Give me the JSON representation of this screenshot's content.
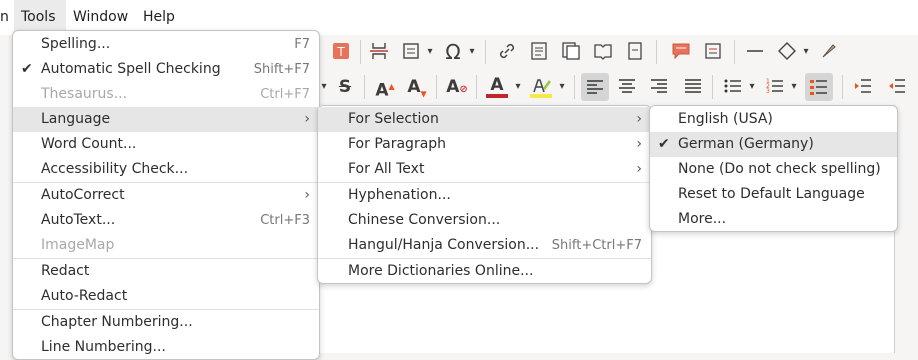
{
  "menubar": {
    "items": [
      {
        "label": "n"
      },
      {
        "label": "Tools"
      },
      {
        "label": "Window"
      },
      {
        "label": "Help"
      }
    ]
  },
  "tools_menu": {
    "items": [
      {
        "label": "Spelling...",
        "accel": "F7"
      },
      {
        "label": "Automatic Spell Checking",
        "accel": "Shift+F7",
        "checked": true
      },
      {
        "label": "Thesaurus...",
        "accel": "Ctrl+F7",
        "disabled": true
      },
      {
        "label": "Language"
      },
      {
        "label": "Word Count..."
      },
      {
        "label": "Accessibility Check..."
      },
      {
        "label": "AutoCorrect"
      },
      {
        "label": "AutoText...",
        "accel": "Ctrl+F3"
      },
      {
        "label": "ImageMap",
        "disabled": true
      },
      {
        "label": "Redact"
      },
      {
        "label": "Auto-Redact"
      },
      {
        "label": "Chapter Numbering..."
      },
      {
        "label": "Line Numbering..."
      }
    ]
  },
  "language_menu": {
    "items": [
      {
        "label": "For Selection"
      },
      {
        "label": "For Paragraph"
      },
      {
        "label": "For All Text"
      },
      {
        "label": "Hyphenation..."
      },
      {
        "label": "Chinese Conversion..."
      },
      {
        "label": "Hangul/Hanja Conversion...",
        "accel": "Shift+Ctrl+F7"
      },
      {
        "label": "More Dictionaries Online..."
      }
    ]
  },
  "selection_menu": {
    "items": [
      {
        "label": "English (USA)"
      },
      {
        "label": "German (Germany)",
        "checked": true
      },
      {
        "label": "None (Do not check spelling)"
      },
      {
        "label": "Reset to Default Language"
      },
      {
        "label": "More..."
      }
    ]
  },
  "toolbar": {
    "special_char_glyph": "Ω",
    "strike_glyph": "S",
    "grow_glyph": "A",
    "shrink_glyph": "A",
    "clear_glyph": "A",
    "font_color_glyph": "A",
    "accent_color": "#e95420"
  }
}
